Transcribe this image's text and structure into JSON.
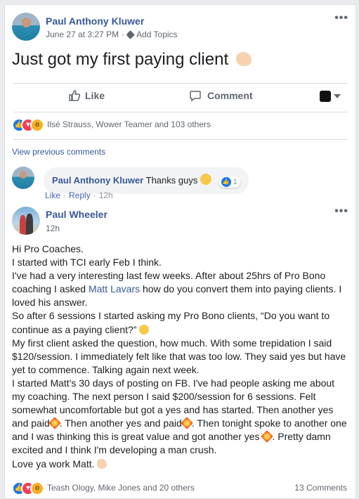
{
  "post": {
    "author": "Paul Anthony Kluwer",
    "date": "June 27 at 3:27 PM",
    "separator": "·",
    "add_topics": "Add Topics",
    "text": "Just got my first paying client",
    "text_emoji": "flexed-biceps"
  },
  "actions": {
    "like": "Like",
    "comment": "Comment"
  },
  "reactions": {
    "icons": [
      "like-icon",
      "love-icon",
      "wow-icon"
    ],
    "summary": "Ilsé Strauss, Wower Teamer and 103 others"
  },
  "view_previous": "View previous comments",
  "comment1": {
    "author": "Paul Anthony Kluwer",
    "text": "Thanks guys",
    "reaction_count": "1",
    "like": "Like",
    "reply": "Reply",
    "separator": "·",
    "time": "12h"
  },
  "comment2": {
    "author": "Paul Wheeler",
    "time": "12h",
    "lines": [
      "Hi Pro Coaches.",
      "I started with TCI early Feb I think.",
      "I've had a very interesting last few weeks. After about 25hrs of Pro Bono coaching I asked",
      "Matt Lavars",
      "how do you convert them into paying clients. I loved his answer.",
      "So after 6 sessions I started asking my Pro Bono clients, “Do you want to continue as a paying client?”",
      "My first client asked the question, how much. With some trepidation I said $120/session. I immediately felt like that was too low. They said yes but have yet to commence. Talking again next week.",
      "I started Matt's 30 days of posting on FB. I've had people asking me about my coaching. The next person I said $200/session for 6 sessions. Felt somewhat uncomfortable but got a yes and has started. Then another yes and paid",
      ". Then another yes and paid",
      ". Then tonight spoke to another one and I was thinking this is great value and got another yes",
      ". Pretty damn excited and I think I'm developing a man crush.",
      "Love ya work Matt."
    ]
  },
  "footer": {
    "reactions_text": "Teash Ology, Mike Jones and 20 others",
    "comments_count": "13 Comments"
  },
  "colors": {
    "link": "#385898",
    "like_blue": "#1877f2",
    "love_red": "#f33e58",
    "wow_yellow": "#f7b125"
  }
}
